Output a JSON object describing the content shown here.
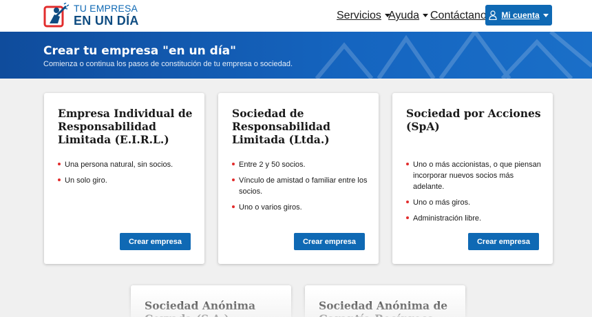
{
  "header": {
    "logo_line1": "TU EMPRESA",
    "logo_line2": "EN UN DÍA",
    "nav": {
      "servicios": "Servicios",
      "ayuda": "Ayuda",
      "contactanos": "Contáctanos",
      "mi_cuenta": "Mi cuenta"
    }
  },
  "banner": {
    "title": "Crear tu empresa \"en un día\"",
    "subtitle": "Comienza o continua los pasos de constitución de tu empresa o sociedad."
  },
  "cards": [
    {
      "title": "Empresa Individual de Responsabilidad Limitada (E.I.R.L.)",
      "items": [
        "Una persona natural, sin socios.",
        "Un solo giro."
      ],
      "button": "Crear empresa"
    },
    {
      "title": "Sociedad de Responsabilidad Limitada (Ltda.)",
      "items": [
        "Entre 2 y 50 socios.",
        "Vínculo de amistad o familiar entre los socios.",
        "Uno o varios giros."
      ],
      "button": "Crear empresa"
    },
    {
      "title": "Sociedad por Acciones (SpA)",
      "items": [
        "Uno o más accionistas, o que piensan incorporar nuevos socios más adelante.",
        "Uno o más giros.",
        "Administración libre."
      ],
      "button": "Crear empresa"
    },
    {
      "title": "Sociedad Anónima Cerrada (S.A.)"
    },
    {
      "title": "Sociedad Anónima de Garantía Recíproca"
    }
  ],
  "colors": {
    "primary": "#0f69b4",
    "bullet": "#e22c2c",
    "logo_red": "#e22c2c"
  }
}
